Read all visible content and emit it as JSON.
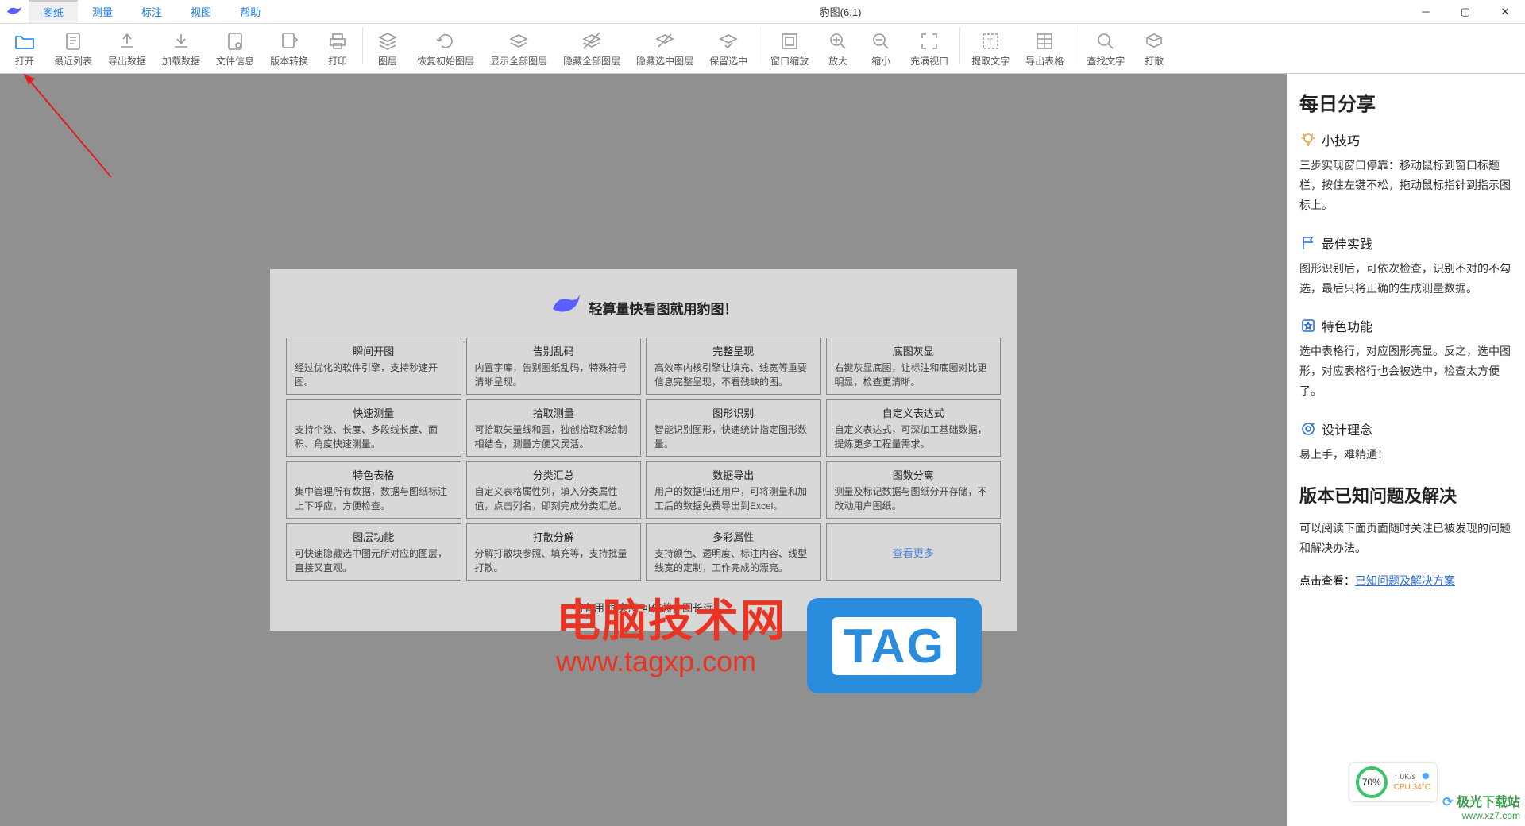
{
  "app": {
    "title": "豹图(6.1)"
  },
  "menu": [
    "图纸",
    "测量",
    "标注",
    "视图",
    "帮助"
  ],
  "ribbon": [
    {
      "label": "打开",
      "icon": "folder"
    },
    {
      "label": "最近列表",
      "icon": "recent"
    },
    {
      "label": "导出数据",
      "icon": "export"
    },
    {
      "label": "加载数据",
      "icon": "import"
    },
    {
      "label": "文件信息",
      "icon": "info"
    },
    {
      "label": "版本转换",
      "icon": "convert"
    },
    {
      "label": "打印",
      "icon": "print"
    },
    {
      "label": "图层",
      "icon": "layers"
    },
    {
      "label": "恢复初始图层",
      "icon": "restore"
    },
    {
      "label": "显示全部图层",
      "icon": "showall"
    },
    {
      "label": "隐藏全部图层",
      "icon": "hideall"
    },
    {
      "label": "隐藏选中图层",
      "icon": "hidesel"
    },
    {
      "label": "保留选中",
      "icon": "keep"
    },
    {
      "label": "窗口缩放",
      "icon": "zoomwin"
    },
    {
      "label": "放大",
      "icon": "zoomin"
    },
    {
      "label": "缩小",
      "icon": "zoomout"
    },
    {
      "label": "充满视口",
      "icon": "fit"
    },
    {
      "label": "提取文字",
      "icon": "extract"
    },
    {
      "label": "导出表格",
      "icon": "table"
    },
    {
      "label": "查找文字",
      "icon": "find"
    },
    {
      "label": "打散",
      "icon": "explode"
    }
  ],
  "welcome": {
    "title": "轻算量快看图就用豹图！",
    "footer": "特有用 很实惠 可信赖，图长远",
    "more": "查看更多",
    "cards": [
      {
        "t": "瞬间开图",
        "d": "经过优化的软件引擎，支持秒速开图。"
      },
      {
        "t": "告别乱码",
        "d": "内置字库，告别图纸乱码，特殊符号清晰呈现。"
      },
      {
        "t": "完整呈现",
        "d": "高效率内核引擎让填充、线宽等重要信息完整呈现，不看残缺的图。"
      },
      {
        "t": "底图灰显",
        "d": "右键灰显底图，让标注和底图对比更明显，检查更清晰。"
      },
      {
        "t": "快速测量",
        "d": "支持个数、长度、多段线长度、面积、角度快速测量。"
      },
      {
        "t": "拾取测量",
        "d": "可拾取矢量线和圆，独创拾取和绘制相结合，测量方便又灵活。"
      },
      {
        "t": "图形识别",
        "d": "智能识别图形，快速统计指定图形数量。"
      },
      {
        "t": "自定义表达式",
        "d": "自定义表达式，可深加工基础数据，提炼更多工程量需求。"
      },
      {
        "t": "特色表格",
        "d": "集中管理所有数据，数据与图纸标注上下呼应，方便检查。"
      },
      {
        "t": "分类汇总",
        "d": "自定义表格属性列，填入分类属性值，点击列名，即刻完成分类汇总。"
      },
      {
        "t": "数据导出",
        "d": "用户的数据归还用户，可将测量和加工后的数据免费导出到Excel。"
      },
      {
        "t": "图数分离",
        "d": "测量及标记数据与图纸分开存储，不改动用户图纸。"
      },
      {
        "t": "图层功能",
        "d": "可快速隐藏选中图元所对应的图层，直接又直观。"
      },
      {
        "t": "打散分解",
        "d": "分解打散块参照、填充等，支持批量打散。"
      },
      {
        "t": "多彩属性",
        "d": "支持颜色、透明度、标注内容、线型线宽的定制，工作完成的漂亮。"
      }
    ]
  },
  "side": {
    "daily": "每日分享",
    "sections": [
      {
        "icon": "bulb",
        "color": "#e8a13a",
        "title": "小技巧",
        "body": "三步实现窗口停靠：移动鼠标到窗口标题栏，按住左键不松，拖动鼠标指针到指示图标上。"
      },
      {
        "icon": "flag",
        "color": "#2a6cd6",
        "title": "最佳实践",
        "body": "图形识别后，可依次检查，识别不对的不勾选，最后只将正确的生成测量数据。"
      },
      {
        "icon": "star",
        "color": "#2a6cd6",
        "title": "特色功能",
        "body": "选中表格行，对应图形亮显。反之，选中图形，对应表格行也会被选中，检查太方便了。"
      },
      {
        "icon": "target",
        "color": "#2a6cd6",
        "title": "设计理念",
        "body": "易上手，难精通！"
      }
    ],
    "issues_title": "版本已知问题及解决",
    "issues_body": "可以阅读下面页面随时关注已被发现的问题和解决办法。",
    "link_prefix": "点击查看：",
    "link_text": "已知问题及解决方案"
  },
  "watermark": {
    "site_cn": "电脑技术网",
    "site_url": "www.tagxp.com",
    "tag": "TAG",
    "aurora": "极光下载站",
    "aurora_url": "www.xz7.com"
  },
  "widget": {
    "percent": "70%",
    "net": "0K/s",
    "cpu": "CPU 34°C"
  }
}
